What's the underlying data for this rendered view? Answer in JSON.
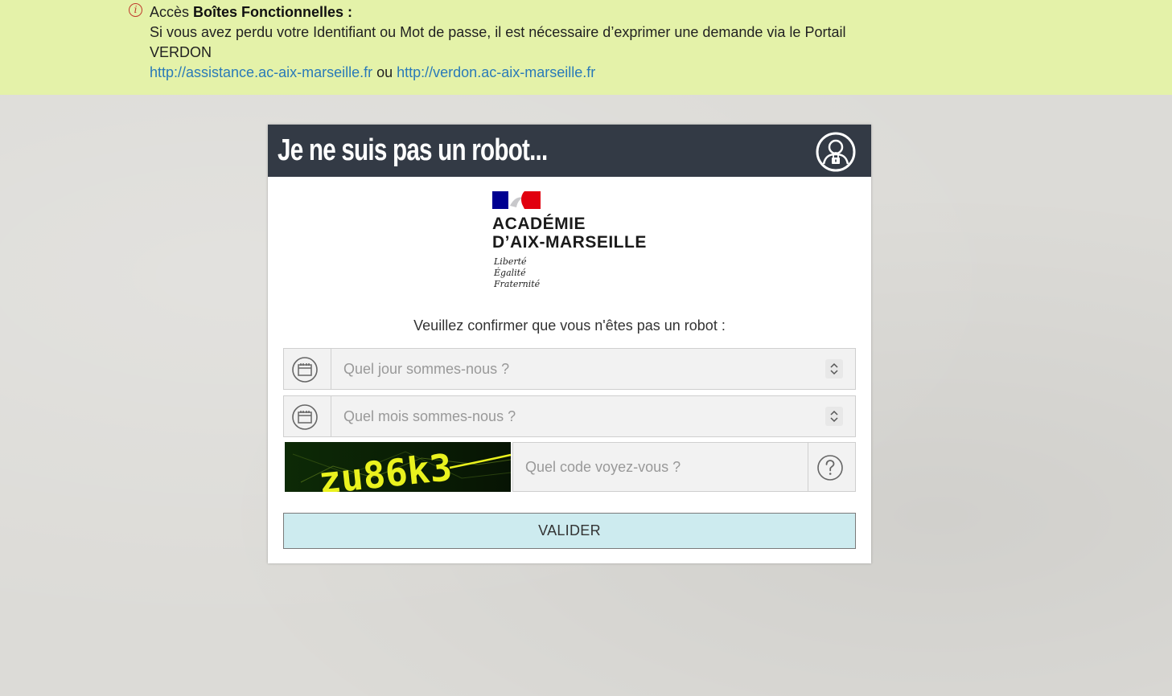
{
  "notice": {
    "prefix": "Accès ",
    "bold": "Boîtes Fonctionnelles :",
    "line2": "Si vous avez perdu votre Identifiant ou Mot de passe, il est nécessaire d’exprimer une demande via le Portail",
    "line3": "VERDON",
    "link1": "http://assistance.ac-aix-marseille.fr",
    "separator": " ou ",
    "link2": "http://verdon.ac-aix-marseille.fr",
    "icon": "info-icon"
  },
  "card": {
    "title": "Je ne suis pas un robot...",
    "header_icon": "user-lock-icon",
    "logo": {
      "line1": "ACADÉMIE",
      "line2": "D’AIX-MARSEILLE",
      "motto1": "Liberté",
      "motto2": "Égalité",
      "motto3": "Fraternité"
    },
    "prompt": "Veuillez confirmer que vous n'êtes pas un robot :",
    "day_placeholder": "Quel jour sommes-nous ?",
    "month_placeholder": "Quel mois sommes-nous ?",
    "captcha_text": "zu86k3",
    "code_placeholder": "Quel code voyez-vous ?",
    "submit_label": "VALIDER"
  },
  "colors": {
    "notice_bg": "#e4f2a9",
    "header_bg": "#333a45",
    "submit_bg": "#cdebef",
    "link": "#2a7ab8",
    "marianne_blue": "#000091",
    "marianne_red": "#e1000f"
  }
}
